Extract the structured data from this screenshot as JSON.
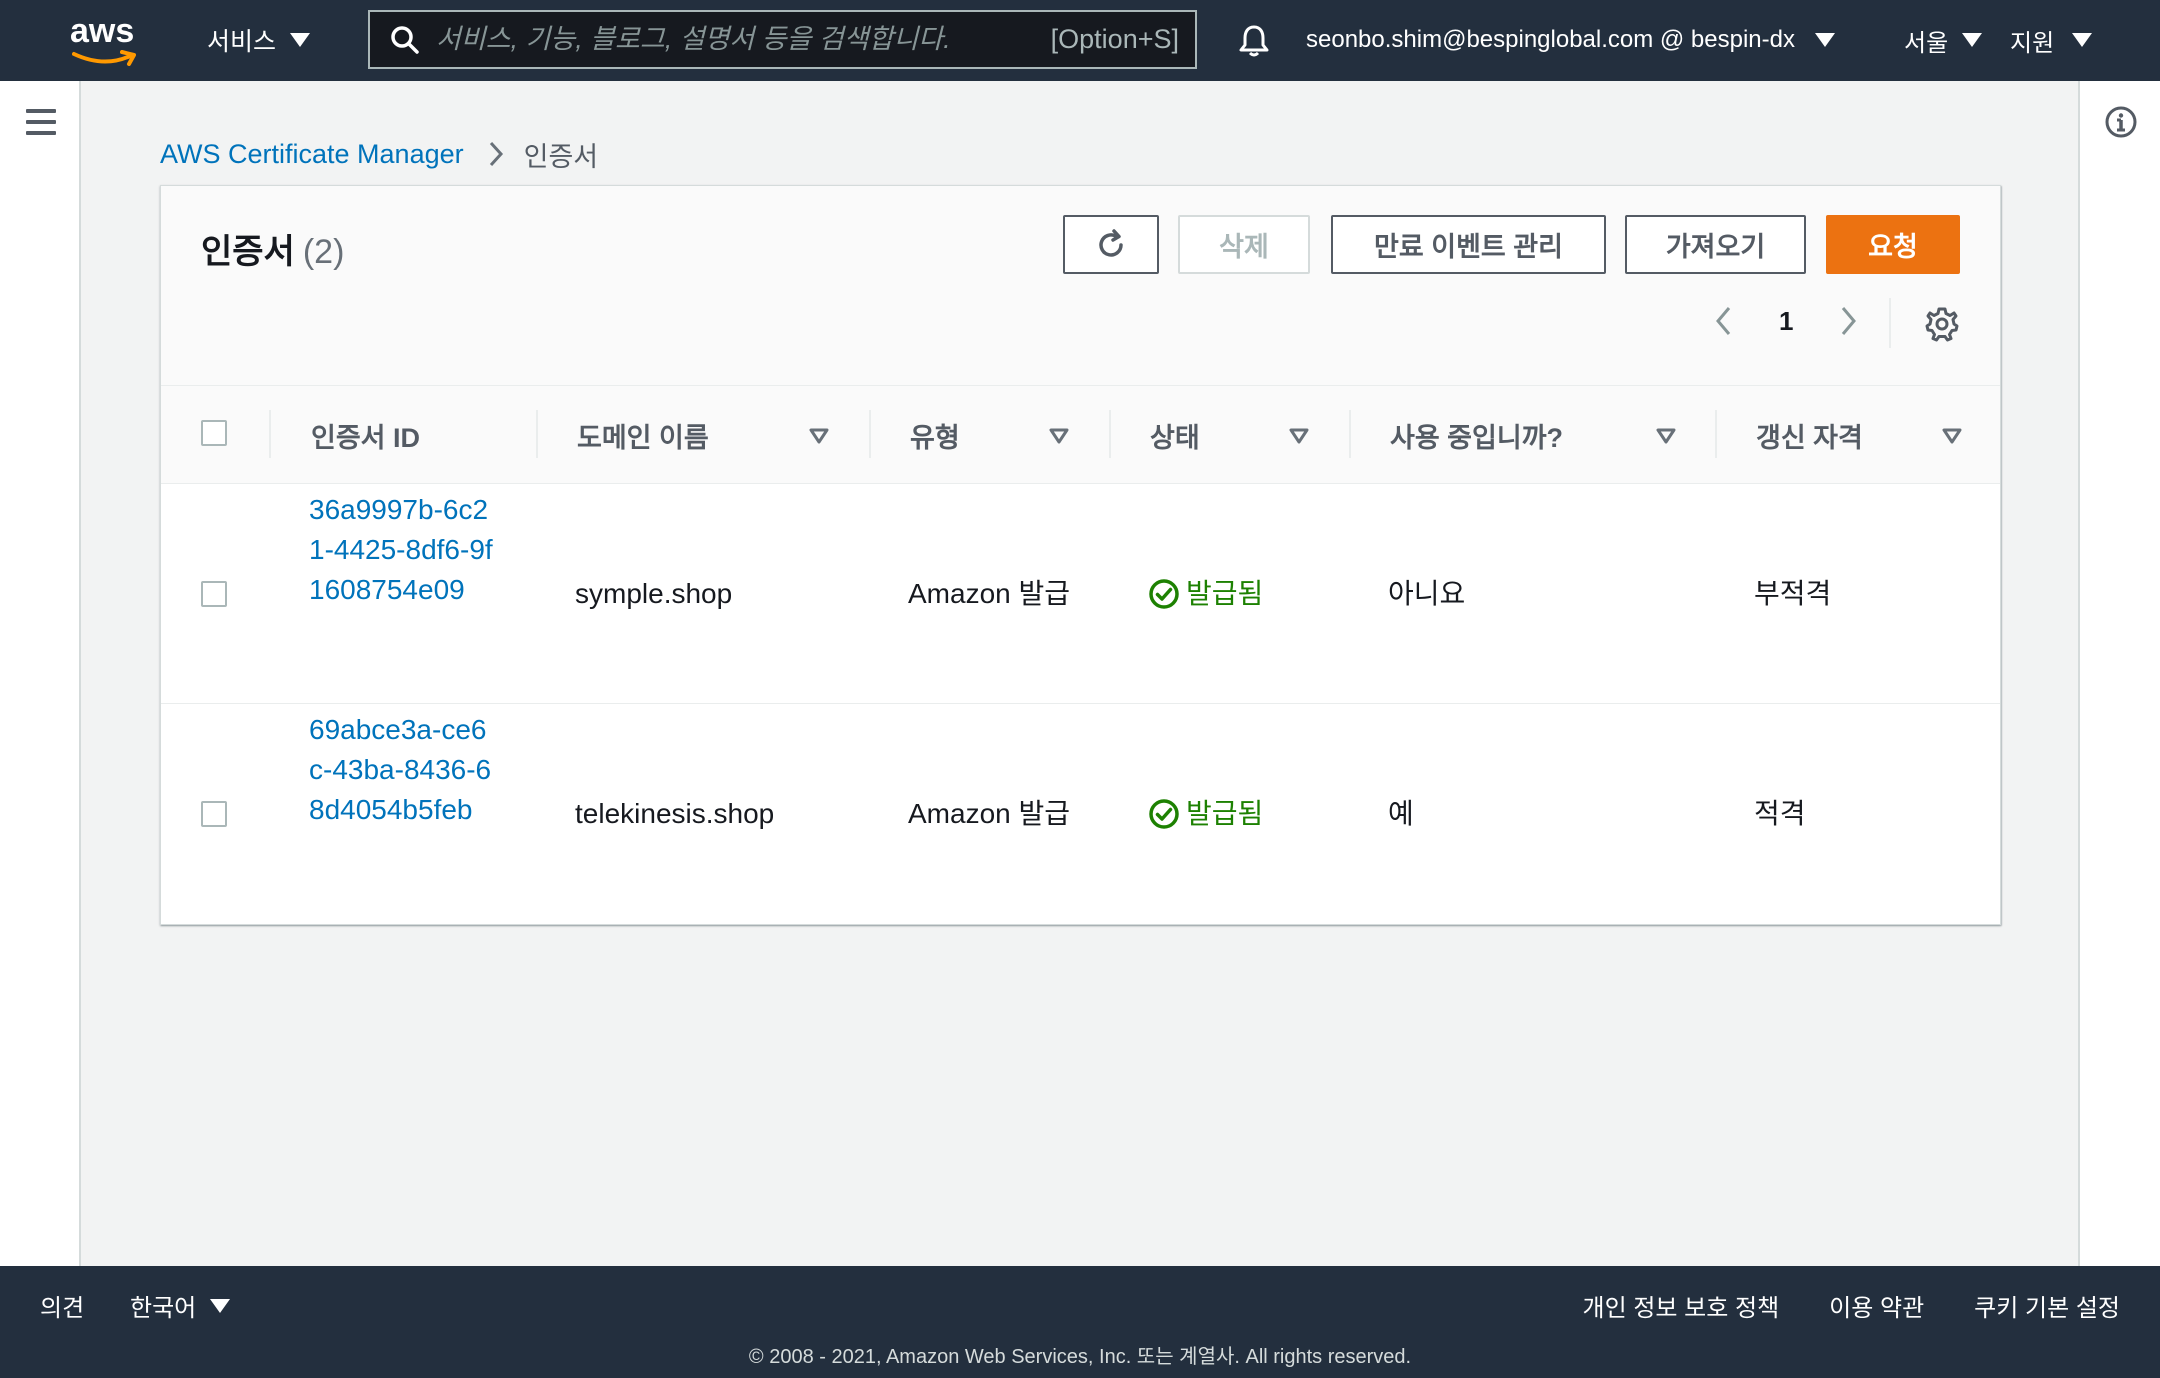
{
  "topnav": {
    "logo_text": "aws",
    "services_label": "서비스",
    "search_placeholder": "서비스, 기능, 블로그, 설명서 등을 검색합니다.",
    "search_shortcut": "[Option+S]",
    "account_label": "seonbo.shim@bespinglobal.com @ bespin-dx",
    "region_label": "서울",
    "support_label": "지원"
  },
  "breadcrumb": {
    "service": "AWS Certificate Manager",
    "current": "인증서"
  },
  "card": {
    "title": "인증서",
    "count": "(2)",
    "buttons": {
      "delete": "삭제",
      "manage_expiry": "만료 이벤트 관리",
      "import": "가져오기",
      "request": "요청"
    },
    "page_number": "1"
  },
  "table": {
    "columns": [
      "인증서 ID",
      "도메인 이름",
      "유형",
      "상태",
      "사용 중입니까?",
      "갱신 자격"
    ],
    "rows": [
      {
        "id": "36a9997b-6c21-4425-8df6-9f1608754e09",
        "domain": "symple.shop",
        "type": "Amazon 발급",
        "status": "발급됨",
        "in_use": "아니요",
        "renewal": "부적격"
      },
      {
        "id": "69abce3a-ce6c-43ba-8436-68d4054b5feb",
        "domain": "telekinesis.shop",
        "type": "Amazon 발급",
        "status": "발급됨",
        "in_use": "예",
        "renewal": "적격"
      }
    ]
  },
  "footer": {
    "feedback": "의견",
    "language": "한국어",
    "links": [
      "개인 정보 보호 정책",
      "이용 약관",
      "쿠키 기본 설정"
    ],
    "copyright": "© 2008 - 2021, Amazon Web Services, Inc. 또는 계열사. All rights reserved."
  },
  "colors": {
    "nav_bg": "#232f3e",
    "link": "#0073bb",
    "primary_button": "#ec7211",
    "success": "#1d8102"
  }
}
